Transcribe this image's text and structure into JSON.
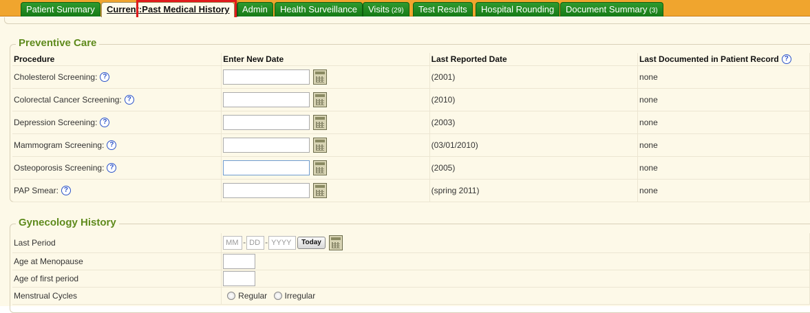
{
  "tabs": [
    {
      "label": "Patient Summary",
      "count": ""
    },
    {
      "label": "Current",
      "count": ""
    },
    {
      "label": "Past Medical History",
      "count": ""
    },
    {
      "label": "Admin",
      "count": ""
    },
    {
      "label": "Health Surveillance",
      "count": ""
    },
    {
      "label": "Visits",
      "count": "(29)"
    },
    {
      "label": "Test Results",
      "count": ""
    },
    {
      "label": "Hospital Rounding",
      "count": ""
    },
    {
      "label": "Document Summary",
      "count": "(3)"
    }
  ],
  "active_tab": "Past Medical History",
  "preventive_care": {
    "title": "Preventive Care",
    "headers": {
      "procedure": "Procedure",
      "enter_new_date": "Enter New Date",
      "last_reported": "Last Reported Date",
      "last_documented": "Last Documented in Patient Record"
    },
    "rows": [
      {
        "procedure": "Cholesterol Screening:",
        "new_date": "",
        "last_reported": "(2001)",
        "last_documented": "none"
      },
      {
        "procedure": "Colorectal Cancer Screening:",
        "new_date": "",
        "last_reported": "(2010)",
        "last_documented": "none"
      },
      {
        "procedure": "Depression Screening:",
        "new_date": "",
        "last_reported": "(2003)",
        "last_documented": "none"
      },
      {
        "procedure": "Mammogram Screening:",
        "new_date": "",
        "last_reported": "(03/01/2010)",
        "last_documented": "none"
      },
      {
        "procedure": "Osteoporosis Screening:",
        "new_date": "",
        "last_reported": "(2005)",
        "last_documented": "none"
      },
      {
        "procedure": "PAP Smear:",
        "new_date": "",
        "last_reported": "(spring 2011)",
        "last_documented": "none"
      }
    ]
  },
  "gynecology_history": {
    "title": "Gynecology History",
    "last_period": {
      "label": "Last Period",
      "mm_placeholder": "MM",
      "dd_placeholder": "DD",
      "yyyy_placeholder": "YYYY",
      "today_label": "Today",
      "separator": "-"
    },
    "age_menopause": {
      "label": "Age at Menopause",
      "value": ""
    },
    "age_first_period": {
      "label": "Age of first period",
      "value": ""
    },
    "menstrual_cycles": {
      "label": "Menstrual Cycles",
      "options": [
        "Regular",
        "Irregular"
      ]
    }
  },
  "icons": {
    "help": "?",
    "calendar": "calendar-icon"
  },
  "colors": {
    "tab_green": "#1f8a1f",
    "tabbar_orange": "#f0a52e",
    "section_title": "#5e8a1c",
    "highlight": "#e01b1b"
  }
}
